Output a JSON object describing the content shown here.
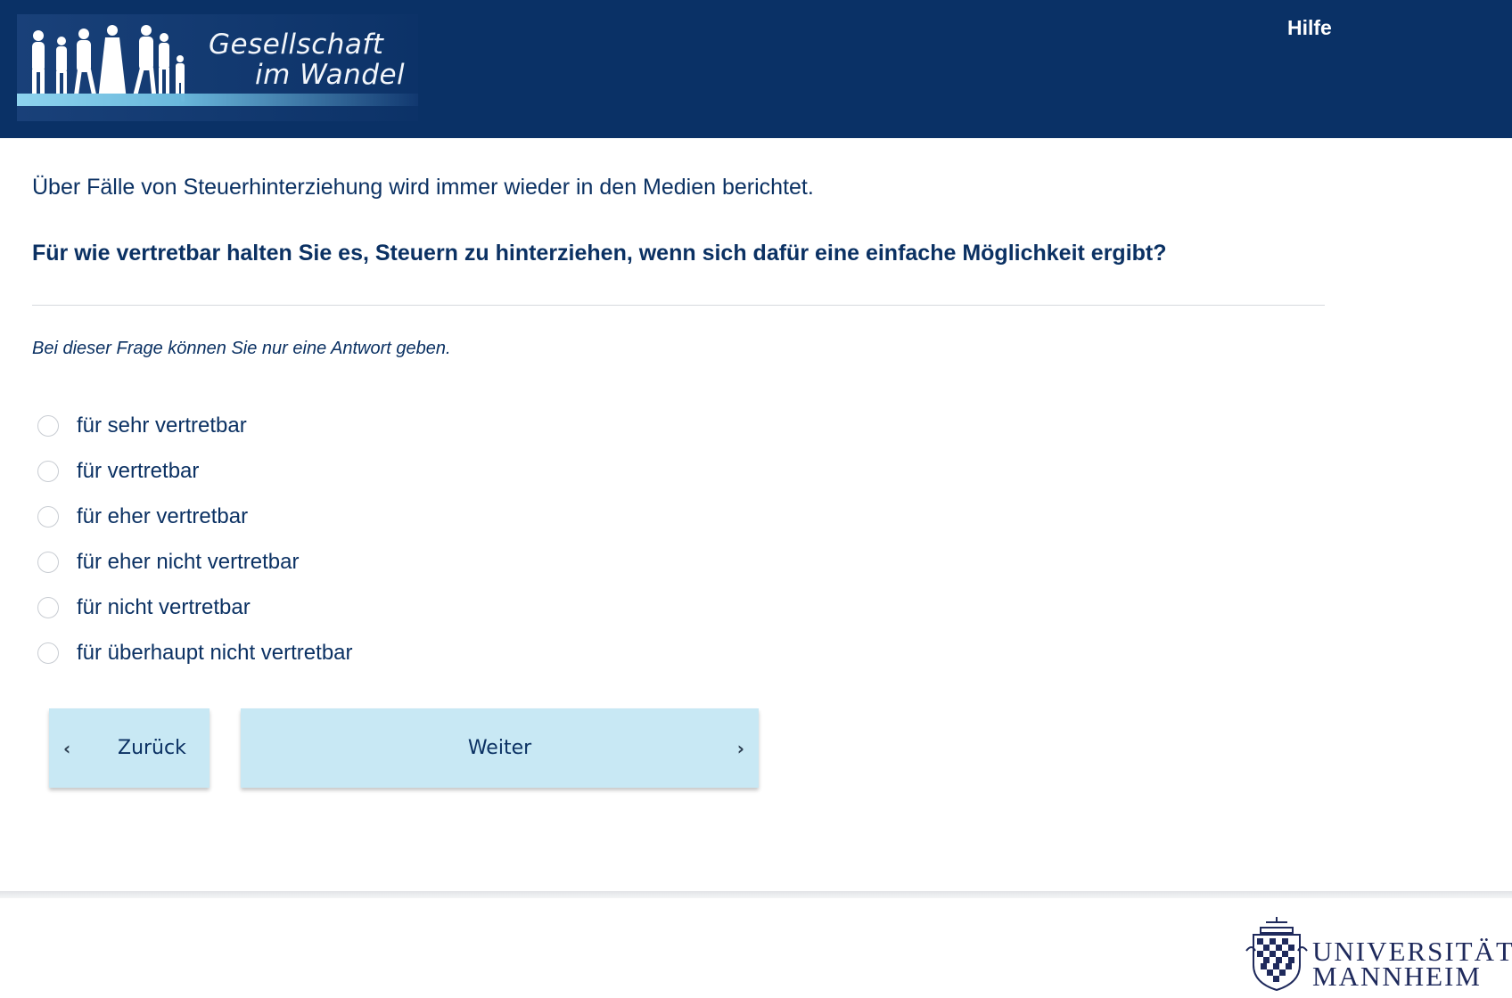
{
  "header": {
    "logo_line_1": "Gesellschaft",
    "logo_line_2": "im Wandel",
    "help_label": "Hilfe"
  },
  "main": {
    "intro": "Über Fälle von Steuerhinterziehung wird immer wieder in den Medien berichtet.",
    "question": "Für wie vertretbar halten Sie es, Steuern zu hinterziehen, wenn sich dafür eine einfache Möglichkeit ergibt?",
    "hint": "Bei dieser Frage können Sie nur eine Antwort geben.",
    "options": [
      {
        "label": "für sehr vertretbar"
      },
      {
        "label": "für vertretbar"
      },
      {
        "label": "für eher vertretbar"
      },
      {
        "label": "für eher nicht vertretbar"
      },
      {
        "label": "für nicht vertretbar"
      },
      {
        "label": "für überhaupt nicht vertretbar"
      }
    ]
  },
  "nav": {
    "back_label": "Zurück",
    "next_label": "Weiter"
  },
  "footer": {
    "university_line_1": "UNIVERSITÄT",
    "university_line_2": "MANNHEIM"
  },
  "colors": {
    "header_bg": "#0a3166",
    "text": "#0b3163",
    "button_bg": "#c8e8f4"
  }
}
